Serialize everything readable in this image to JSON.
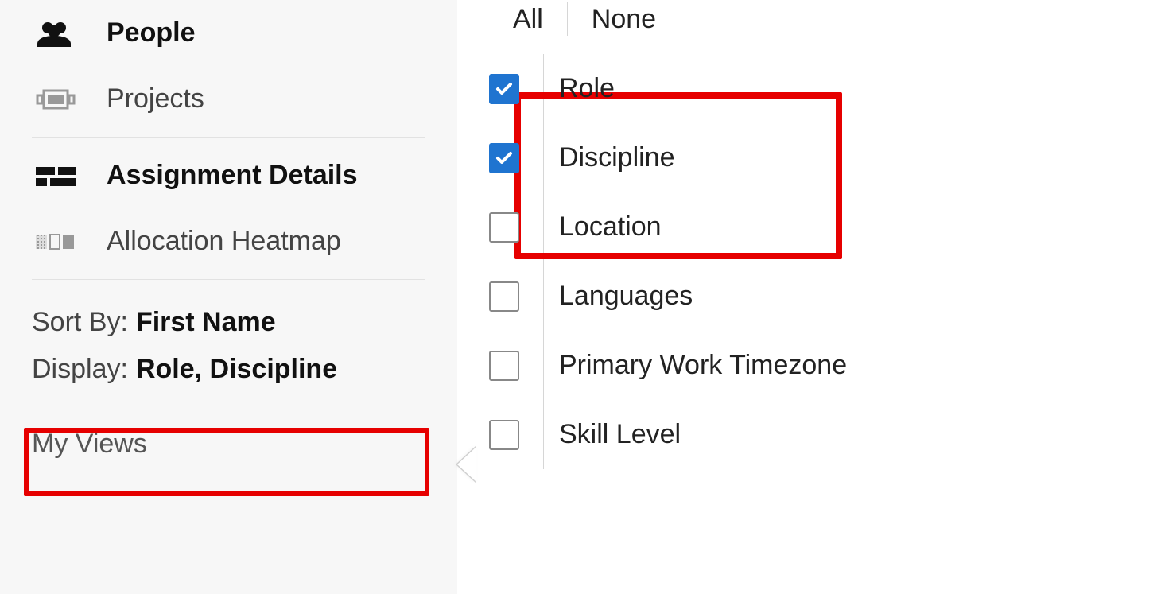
{
  "sidebar": {
    "people": {
      "label": "People",
      "active": true
    },
    "projects": {
      "label": "Projects",
      "active": false
    },
    "assignment": {
      "label": "Assignment Details",
      "active": true
    },
    "heatmap": {
      "label": "Allocation Heatmap",
      "active": false
    },
    "sort": {
      "prefix": "Sort By:",
      "value": "First Name"
    },
    "display": {
      "prefix": "Display:",
      "value": "Role, Discipline"
    },
    "myviews": {
      "label": "My Views"
    }
  },
  "panel": {
    "head": {
      "all": "All",
      "none": "None"
    },
    "options": [
      {
        "label": "Role",
        "checked": true
      },
      {
        "label": "Discipline",
        "checked": true
      },
      {
        "label": "Location",
        "checked": false
      },
      {
        "label": "Languages",
        "checked": false
      },
      {
        "label": "Primary Work Timezone",
        "checked": false
      },
      {
        "label": "Skill Level",
        "checked": false
      }
    ]
  }
}
